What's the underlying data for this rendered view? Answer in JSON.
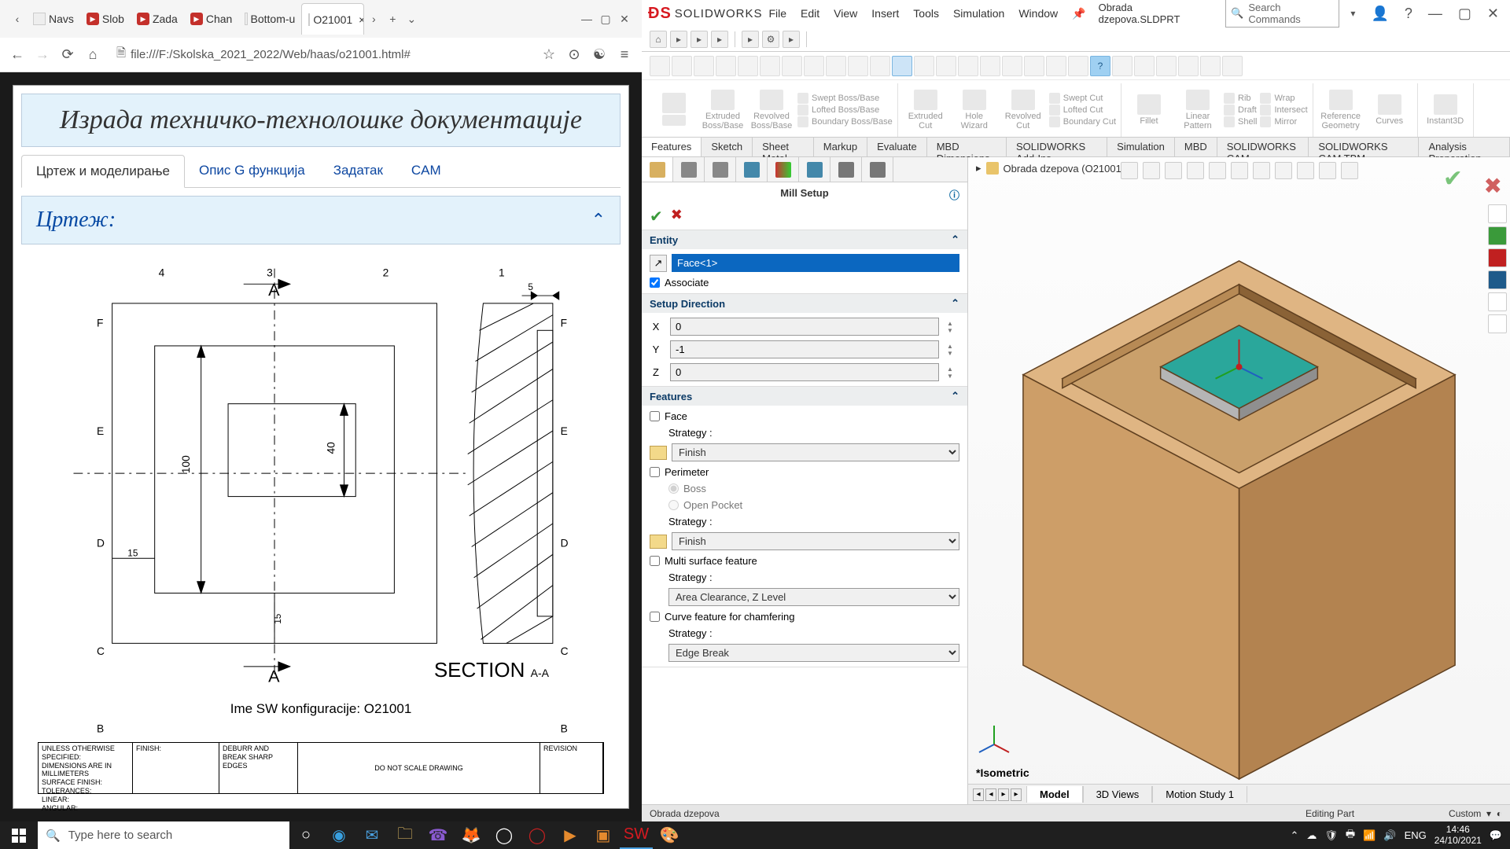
{
  "browser": {
    "tabs": [
      {
        "favicon": "",
        "label": "Navs"
      },
      {
        "favicon": "yt",
        "label": "Slob"
      },
      {
        "favicon": "yt",
        "label": "Zada"
      },
      {
        "favicon": "yt",
        "label": "Chan"
      },
      {
        "favicon": "doc",
        "label": "Bottom-u"
      },
      {
        "favicon": "doc",
        "label": "O21001",
        "active": true,
        "close": "×"
      }
    ],
    "url_prefix": "file:///F:/Skolska_2021_2022/Web/haas/o21001.html#",
    "page_title": "Израда техничко-технолошке документације",
    "page_tabs": [
      "Цртеж и моделирање",
      "Опис G функција",
      "Задатак",
      "CAM"
    ],
    "collapse_label": "Цртеж:",
    "section_label": "SECTION",
    "section_sub": "A-A",
    "caption": "Ime SW konfiguracije: O21001",
    "dims": {
      "d1": "4",
      "d2": "3",
      "d3": "2",
      "d4": "1",
      "a": "A",
      "f": "F",
      "e": "E",
      "d": "D",
      "c": "C",
      "b": "B",
      "v100": "100",
      "v40": "40",
      "v15a": "15",
      "v15b": "15",
      "v5": "5"
    },
    "titleblock": {
      "c1": "UNLESS OTHERWISE SPECIFIED:\nDIMENSIONS ARE IN MILLIMETERS\nSURFACE FINISH:\nTOLERANCES:\n  LINEAR:\n  ANGULAR:",
      "c2": "FINISH:",
      "c3": "DEBURR AND\nBREAK SHARP\nEDGES",
      "c4": "DO NOT SCALE DRAWING",
      "c5": "REVISION"
    }
  },
  "sw": {
    "app_name": "SOLIDWORKS",
    "menus": [
      "File",
      "Edit",
      "View",
      "Insert",
      "Tools",
      "Simulation",
      "Window"
    ],
    "doc": "Obrada dzepova.SLDPRT",
    "search_ph": "Search Commands",
    "ribbon": {
      "groups": [
        {
          "big": [
            {
              "l": "Extruded\nBoss/Base"
            },
            {
              "l": "Revolved\nBoss/Base"
            }
          ],
          "small": [
            "Swept Boss/Base",
            "Lofted Boss/Base",
            "Boundary Boss/Base"
          ]
        },
        {
          "big": [
            {
              "l": "Extruded\nCut"
            },
            {
              "l": "Hole\nWizard"
            },
            {
              "l": "Revolved\nCut"
            }
          ],
          "small": [
            "Swept Cut",
            "Lofted Cut",
            "Boundary Cut"
          ]
        },
        {
          "big": [
            {
              "l": "Fillet"
            },
            {
              "l": "Linear\nPattern"
            }
          ],
          "small": [
            "Rib",
            "Draft",
            "Shell"
          ],
          "small2": [
            "Wrap",
            "Intersect",
            "Mirror"
          ]
        },
        {
          "big": [
            {
              "l": "Reference\nGeometry"
            },
            {
              "l": "Curves"
            }
          ]
        },
        {
          "big": [
            {
              "l": "Instant3D"
            }
          ]
        }
      ]
    },
    "cmd_tabs": [
      "Features",
      "Sketch",
      "Sheet Metal",
      "Markup",
      "Evaluate",
      "MBD Dimensions",
      "SOLIDWORKS Add-Ins",
      "Simulation",
      "MBD",
      "SOLIDWORKS CAM",
      "SOLIDWORKS CAM TBM",
      "Analysis Preparation"
    ],
    "breadcrumb": "Obrada dzepova  (O21001...",
    "pm": {
      "title": "Mill Setup",
      "entity_h": "Entity",
      "entity_val": "Face<1>",
      "associate": "Associate",
      "dir_h": "Setup Direction",
      "x": "X",
      "xv": "0",
      "y": "Y",
      "yv": "-1",
      "z": "Z",
      "zv": "0",
      "feat_h": "Features",
      "face": "Face",
      "strategy": "Strategy :",
      "finish": "Finish",
      "perimeter": "Perimeter",
      "boss": "Boss",
      "open_pocket": "Open Pocket",
      "multi": "Multi surface feature",
      "area_clear": "Area Clearance, Z Level",
      "curve": "Curve feature for chamfering",
      "edge_break": "Edge Break"
    },
    "iso": "*Isometric",
    "bottom_tabs": [
      "Model",
      "3D Views",
      "Motion Study 1"
    ],
    "status_left": "Obrada dzepova",
    "status_right": "Editing Part",
    "status_custom": "Custom"
  },
  "taskbar": {
    "search_ph": "Type here to search",
    "lang": "ENG",
    "time": "14:46",
    "date": "24/10/2021"
  }
}
